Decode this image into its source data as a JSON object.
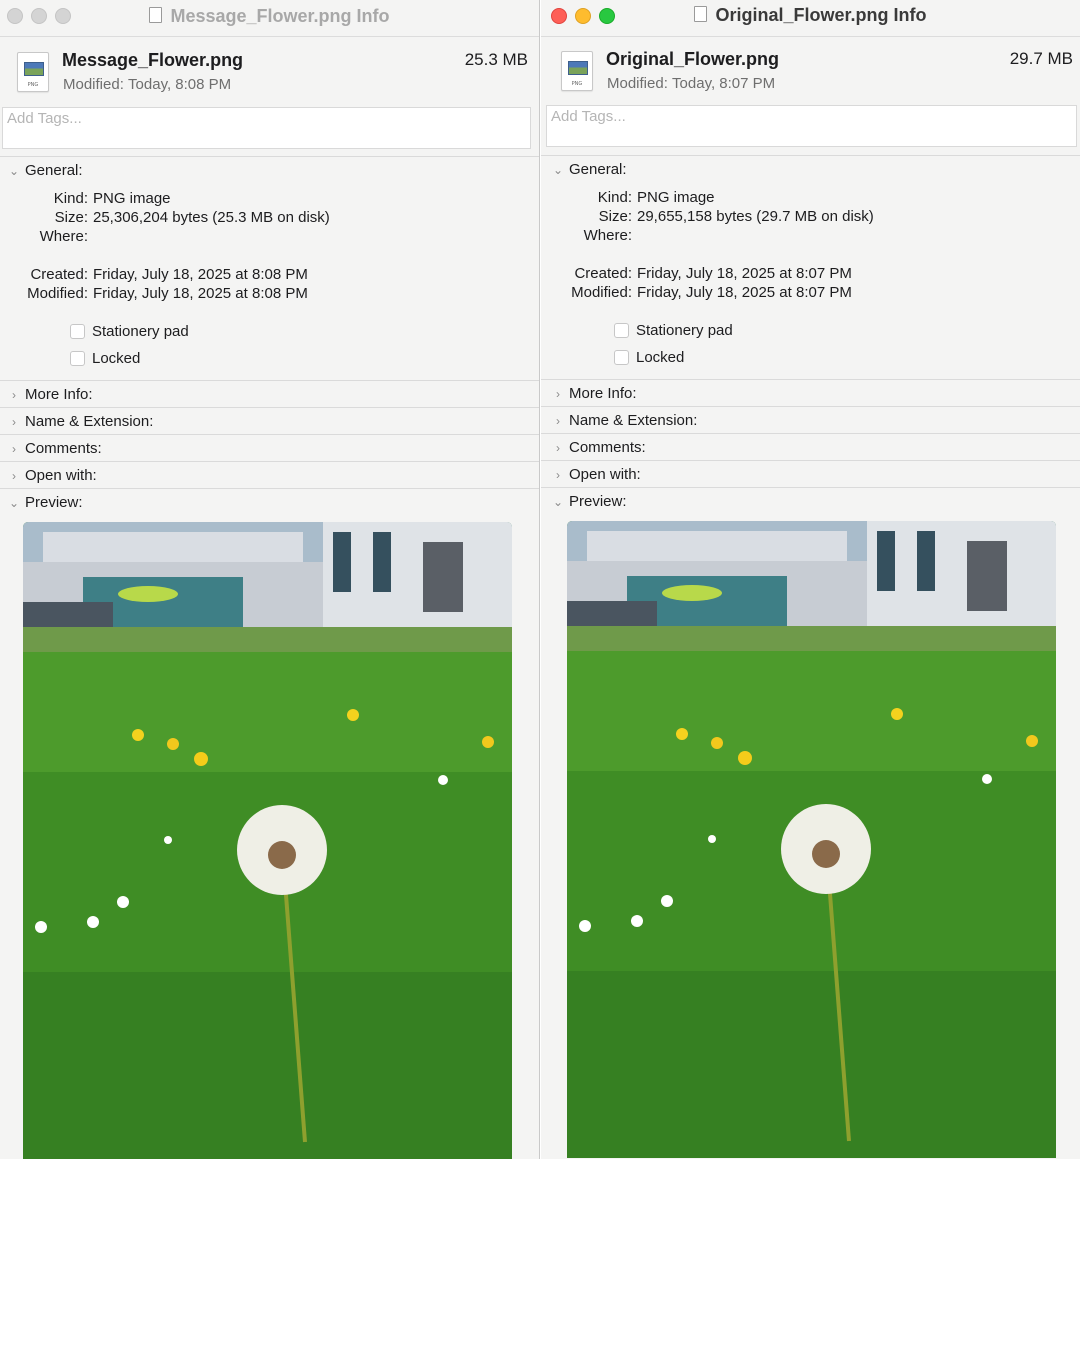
{
  "windows": [
    {
      "title": "Message_Flower.png Info",
      "active": false,
      "filename": "Message_Flower.png",
      "modified_label": "Modified:",
      "modified_value": "Today, 8:08 PM",
      "size_badge": "25.3 MB",
      "tags_placeholder": "Add Tags...",
      "general": {
        "heading": "General:",
        "kind_label": "Kind:",
        "kind": "PNG image",
        "size_label": "Size:",
        "size": "25,306,204 bytes (25.3 MB on disk)",
        "where_label": "Where:",
        "where": "",
        "created_label": "Created:",
        "created": "Friday, July 18, 2025 at 8:08 PM",
        "modified_label": "Modified:",
        "modified": "Friday, July 18, 2025 at 8:08 PM",
        "stationery": "Stationery pad",
        "locked": "Locked"
      },
      "sections": [
        "More Info:",
        "Name & Extension:",
        "Comments:",
        "Open with:"
      ],
      "preview_heading": "Preview:"
    },
    {
      "title": "Original_Flower.png Info",
      "active": true,
      "filename": "Original_Flower.png",
      "modified_label": "Modified:",
      "modified_value": "Today, 8:07 PM",
      "size_badge": "29.7 MB",
      "tags_placeholder": "Add Tags...",
      "general": {
        "heading": "General:",
        "kind_label": "Kind:",
        "kind": "PNG image",
        "size_label": "Size:",
        "size": "29,655,158 bytes (29.7 MB on disk)",
        "where_label": "Where:",
        "where": "",
        "created_label": "Created:",
        "created": "Friday, July 18, 2025 at 8:07 PM",
        "modified_label": "Modified:",
        "modified": "Friday, July 18, 2025 at 8:07 PM",
        "stationery": "Stationery pad",
        "locked": "Locked"
      },
      "sections": [
        "More Info:",
        "Name & Extension:",
        "Comments:",
        "Open with:"
      ],
      "preview_heading": "Preview:"
    }
  ],
  "file_icon_ext": "PNG",
  "icons": {
    "collapsed": "chevron-right-icon",
    "expanded": "chevron-down-icon",
    "file": "png-file-icon"
  },
  "colors": {
    "window_bg": "#f4f4f3",
    "close": "#fe5f57",
    "minimize": "#febc2e",
    "zoom": "#28c840",
    "inactive_light": "#d4d4d4"
  }
}
